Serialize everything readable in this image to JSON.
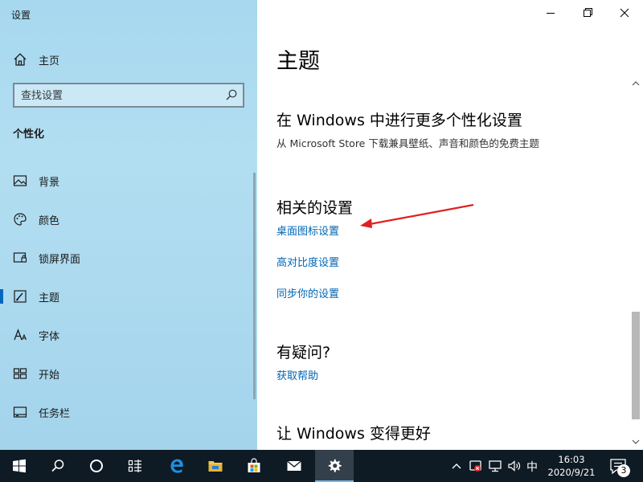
{
  "window": {
    "title": "设置"
  },
  "sidebar": {
    "home_label": "主页",
    "search_placeholder": "查找设置",
    "section_title": "个性化",
    "items": [
      {
        "label": "背景",
        "icon": "picture-icon"
      },
      {
        "label": "颜色",
        "icon": "palette-icon"
      },
      {
        "label": "锁屏界面",
        "icon": "lock-screen-icon"
      },
      {
        "label": "主题",
        "icon": "brush-icon",
        "active": true
      },
      {
        "label": "字体",
        "icon": "font-icon"
      },
      {
        "label": "开始",
        "icon": "start-icon"
      },
      {
        "label": "任务栏",
        "icon": "taskbar-icon"
      }
    ]
  },
  "main": {
    "title": "主题",
    "more_heading": "在 Windows 中进行更多个性化设置",
    "more_desc": "从 Microsoft Store 下载兼具壁纸、声音和颜色的免费主题",
    "related_heading": "相关的设置",
    "related_links": [
      "桌面图标设置",
      "高对比度设置",
      "同步你的设置"
    ],
    "help_heading": "有疑问?",
    "help_link": "获取帮助",
    "better_heading": "让 Windows 变得更好"
  },
  "taskbar": {
    "ime": "中",
    "time": "16:03",
    "date": "2020/9/21",
    "notification_count": "3",
    "accent": "#76b9ed"
  },
  "colors": {
    "link": "#0066b4",
    "annotation_arrow": "#e02020",
    "sidebar_bg": "#a6d8ef"
  }
}
